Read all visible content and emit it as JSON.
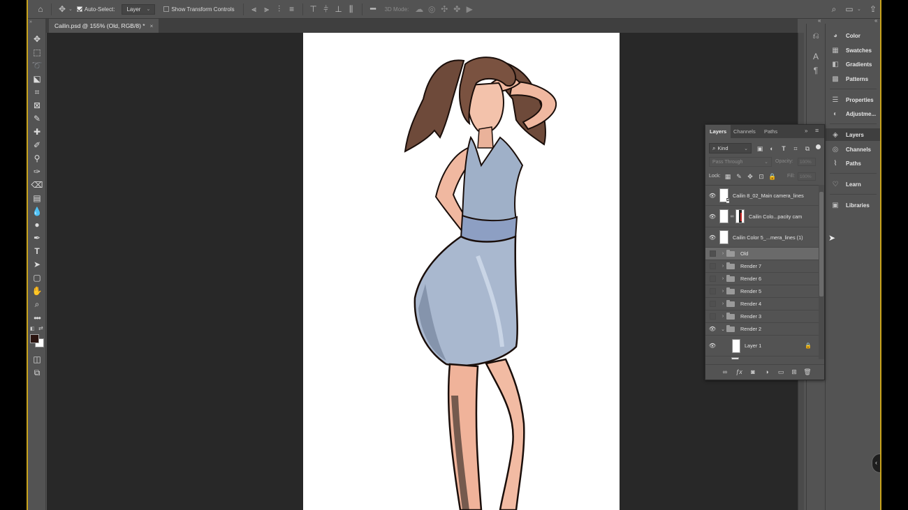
{
  "colors": {
    "accent_frame": "#c9a31c",
    "app_bg": "#535353",
    "canvas_bg": "#282828"
  },
  "options_bar": {
    "auto_select_label": "Auto-Select:",
    "auto_select_target": "Layer",
    "show_transform_label": "Show Transform Controls",
    "mode_3d_label": "3D Mode:"
  },
  "document": {
    "tab_title": "Cailin.psd @ 155% (Old, RGB/8) *",
    "close_glyph": "×"
  },
  "right_panel": {
    "items": [
      {
        "label": "Color",
        "icon": "color-palette-icon"
      },
      {
        "label": "Swatches",
        "icon": "swatches-grid-icon"
      },
      {
        "label": "Gradients",
        "icon": "gradient-icon"
      },
      {
        "label": "Patterns",
        "icon": "pattern-icon"
      },
      {
        "label": "Properties",
        "icon": "properties-sliders-icon"
      },
      {
        "label": "Adjustme...",
        "icon": "adjustment-circle-icon"
      },
      {
        "label": "Layers",
        "icon": "layers-stack-icon"
      },
      {
        "label": "Channels",
        "icon": "channels-icon"
      },
      {
        "label": "Paths",
        "icon": "pen-path-icon"
      },
      {
        "label": "Learn",
        "icon": "lightbulb-icon"
      },
      {
        "label": "Libraries",
        "icon": "libraries-icon"
      }
    ]
  },
  "layers_panel": {
    "tabs": [
      "Layers",
      "Channels",
      "Paths"
    ],
    "kind_label": "Kind",
    "blend_mode": "Pass Through",
    "opacity_label": "Opacity:",
    "opacity_value": "100%",
    "lock_label": "Lock:",
    "fill_label": "Fill:",
    "fill_value": "100%",
    "layers": [
      {
        "name": "Cailin 8_02_Main camera_lines",
        "visible": true,
        "type": "smart"
      },
      {
        "name": "Cailin Colo...pacity cam",
        "visible": true,
        "type": "masked"
      },
      {
        "name": "Cailin Color 5_...mera_lines (1)",
        "visible": true,
        "type": "image"
      },
      {
        "name": "Old",
        "visible": false,
        "type": "group",
        "selected": true
      },
      {
        "name": "Render 7",
        "visible": false,
        "type": "group"
      },
      {
        "name": "Render 6",
        "visible": false,
        "type": "group"
      },
      {
        "name": "Render 5",
        "visible": false,
        "type": "group"
      },
      {
        "name": "Render 4",
        "visible": false,
        "type": "group"
      },
      {
        "name": "Render 3",
        "visible": false,
        "type": "group"
      },
      {
        "name": "Render 2",
        "visible": true,
        "type": "group-open"
      },
      {
        "name": "Layer 1",
        "visible": true,
        "type": "locked"
      }
    ]
  }
}
